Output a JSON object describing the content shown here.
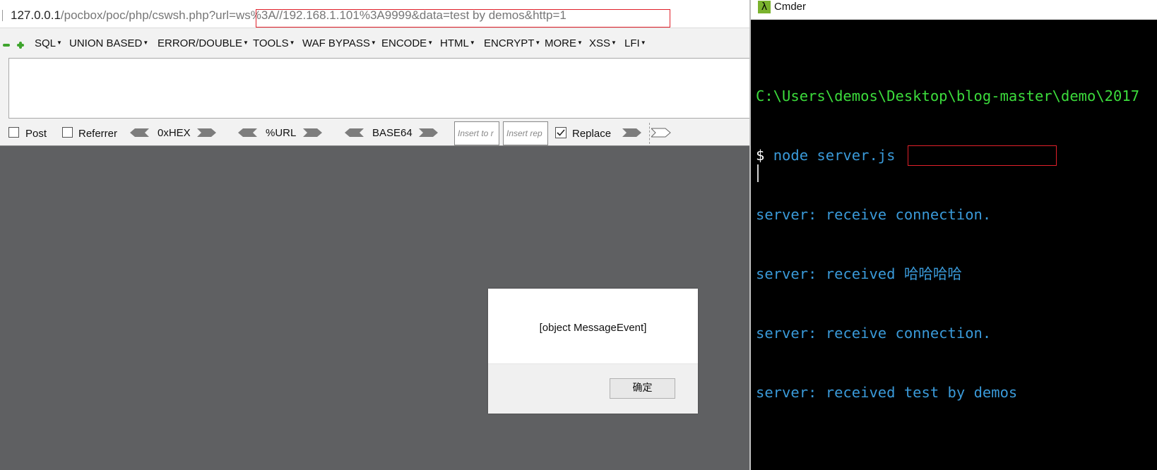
{
  "browser": {
    "url": {
      "host": "127.0.0.1",
      "path": "/pocbox/poc/php/cswsh.php?url",
      "query": "=ws%3A//192.168.1.101%3A9999&data=test by demos&http=1"
    },
    "hackbar_menu": [
      {
        "id": "sql",
        "label": "SQL"
      },
      {
        "id": "union",
        "label": "UNION BASED"
      },
      {
        "id": "error",
        "label": "ERROR/DOUBLE"
      },
      {
        "id": "tools",
        "label": "TOOLS"
      },
      {
        "id": "waf",
        "label": "WAF BYPASS"
      },
      {
        "id": "encode",
        "label": "ENCODE"
      },
      {
        "id": "html",
        "label": "HTML"
      },
      {
        "id": "encrypt",
        "label": "ENCRYPT"
      },
      {
        "id": "more",
        "label": "MORE"
      },
      {
        "id": "xss",
        "label": "XSS"
      },
      {
        "id": "lfi",
        "label": "LFI"
      }
    ],
    "options": {
      "post_label": "Post",
      "post_checked": false,
      "referrer_label": "Referrer",
      "referrer_checked": false,
      "hex_label": "0xHEX",
      "url_label": "%URL",
      "base64_label": "BASE64",
      "insert_to_placeholder": "Insert to r",
      "insert_replace_placeholder": "Insert rep",
      "replace_label": "Replace",
      "replace_checked": true
    },
    "alert": {
      "message": "[object MessageEvent]",
      "ok_label": "确定"
    }
  },
  "cmder": {
    "title": "Cmder",
    "icon": "lambda-icon",
    "lines": [
      {
        "kind": "path",
        "text": "C:\\Users\\demos\\Desktop\\blog-master\\demo\\2017"
      },
      {
        "kind": "command",
        "prompt": "$ ",
        "text": "node server.js"
      },
      {
        "kind": "output",
        "text": "server: receive connection."
      },
      {
        "kind": "output",
        "text": "server: received 哈哈哈哈"
      },
      {
        "kind": "output",
        "text": "server: receive connection."
      },
      {
        "kind": "output-highlight",
        "text": "server: received ",
        "highlight": "test by demos"
      }
    ]
  },
  "colors": {
    "highlight_box": "#e0202a",
    "terminal_path": "#3cdc3c",
    "terminal_output": "#3a9ad9",
    "page_overlay": "#5f6062"
  }
}
